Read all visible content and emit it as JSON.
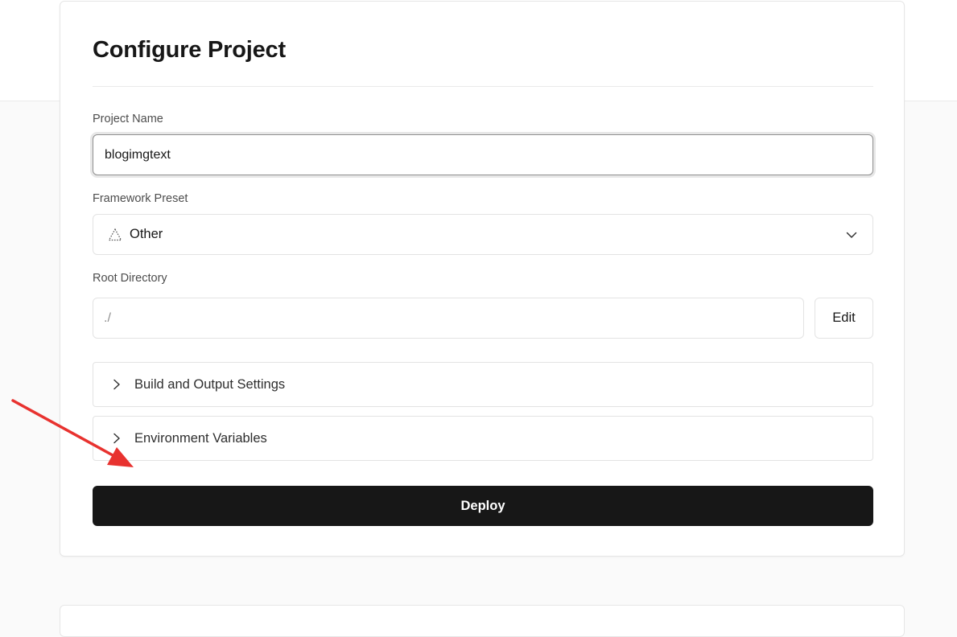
{
  "card": {
    "title": "Configure Project"
  },
  "project_name": {
    "label": "Project Name",
    "value": "blogimgtext"
  },
  "framework_preset": {
    "label": "Framework Preset",
    "selected": "Other",
    "icon": "triangle-dotted-icon"
  },
  "root_directory": {
    "label": "Root Directory",
    "value": "./",
    "edit_label": "Edit"
  },
  "sections": [
    {
      "label": "Build and Output Settings",
      "icon": "chevron-right-icon"
    },
    {
      "label": "Environment Variables",
      "icon": "chevron-right-icon"
    }
  ],
  "deploy": {
    "label": "Deploy"
  },
  "colors": {
    "deploy_bg": "#171717",
    "annotation_arrow": "#e8322f"
  }
}
